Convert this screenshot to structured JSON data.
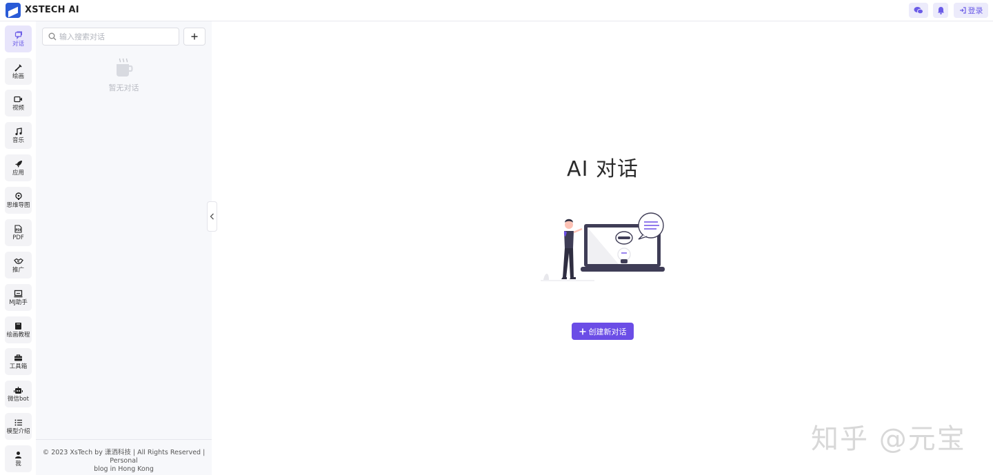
{
  "app": {
    "title": "XSTECH AI"
  },
  "header": {
    "login_label": "登录"
  },
  "rail": {
    "items": [
      {
        "label": "对话",
        "icon": "chat-icon",
        "active": true
      },
      {
        "label": "绘画",
        "icon": "brush-icon"
      },
      {
        "label": "视频",
        "icon": "video-icon"
      },
      {
        "label": "音乐",
        "icon": "music-icon"
      },
      {
        "label": "应用",
        "icon": "rocket-icon"
      },
      {
        "label": "思维导图",
        "icon": "mindmap-icon"
      },
      {
        "label": "PDF",
        "icon": "pdf-icon"
      },
      {
        "label": "推广",
        "icon": "handshake-icon"
      },
      {
        "label": "MJ助手",
        "icon": "monitor-icon"
      },
      {
        "label": "绘画教程",
        "icon": "book-icon"
      },
      {
        "label": "工具箱",
        "icon": "toolbox-icon"
      },
      {
        "label": "微信bot",
        "icon": "robot-icon"
      },
      {
        "label": "模型介绍",
        "icon": "list-icon"
      },
      {
        "label": "我",
        "icon": "user-icon"
      }
    ]
  },
  "conversations": {
    "search_placeholder": "输入搜索对话",
    "empty_text": "暂无对话",
    "footer_line1": "© 2023 XsTech by 潇洒科技 | All Rights Reserved | Personal",
    "footer_line2": "blog in Hong Kong"
  },
  "main": {
    "title": "AI 对话",
    "create_label": "创建新对话"
  },
  "watermark": "知乎 @元宝",
  "colors": {
    "accent": "#6b4de6",
    "rail_active_bg": "#e8e5fb",
    "panel_bg": "#f7f8fb"
  }
}
